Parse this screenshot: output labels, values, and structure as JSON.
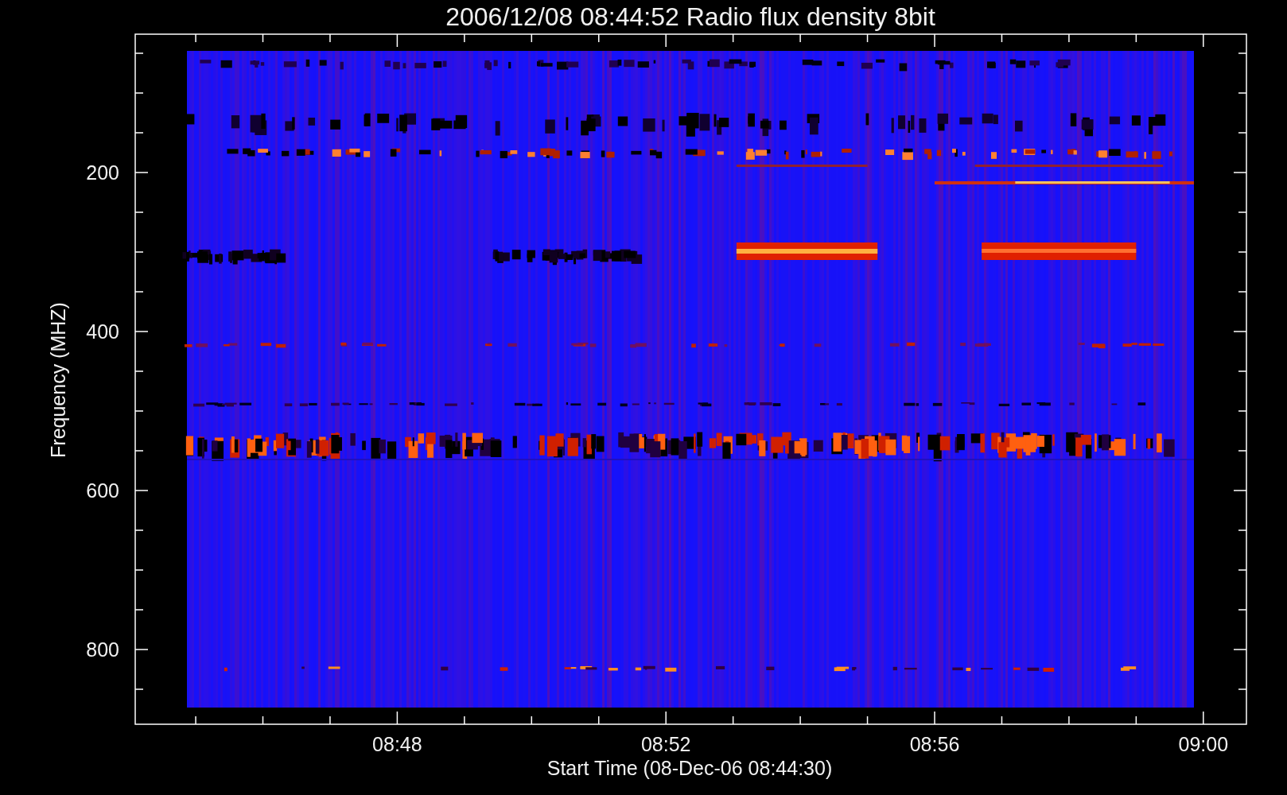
{
  "title": "2006/12/08 08:44:52 Radio flux density 8bit",
  "y_axis": {
    "label": "Frequency (MHZ)",
    "ticks": [
      "200",
      "400",
      "600",
      "800"
    ]
  },
  "x_axis": {
    "label": "Start Time (08-Dec-06 08:44:30)",
    "ticks": [
      "08:48",
      "08:52",
      "08:56",
      "09:00"
    ]
  }
}
